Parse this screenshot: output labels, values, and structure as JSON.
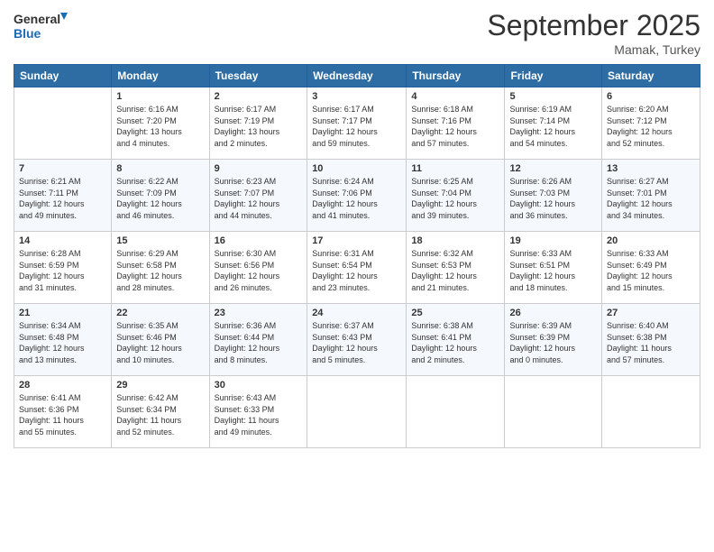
{
  "logo": {
    "line1": "General",
    "line2": "Blue"
  },
  "title": "September 2025",
  "location": "Mamak, Turkey",
  "days_header": [
    "Sunday",
    "Monday",
    "Tuesday",
    "Wednesday",
    "Thursday",
    "Friday",
    "Saturday"
  ],
  "weeks": [
    [
      {
        "day": "",
        "info": ""
      },
      {
        "day": "1",
        "info": "Sunrise: 6:16 AM\nSunset: 7:20 PM\nDaylight: 13 hours\nand 4 minutes."
      },
      {
        "day": "2",
        "info": "Sunrise: 6:17 AM\nSunset: 7:19 PM\nDaylight: 13 hours\nand 2 minutes."
      },
      {
        "day": "3",
        "info": "Sunrise: 6:17 AM\nSunset: 7:17 PM\nDaylight: 12 hours\nand 59 minutes."
      },
      {
        "day": "4",
        "info": "Sunrise: 6:18 AM\nSunset: 7:16 PM\nDaylight: 12 hours\nand 57 minutes."
      },
      {
        "day": "5",
        "info": "Sunrise: 6:19 AM\nSunset: 7:14 PM\nDaylight: 12 hours\nand 54 minutes."
      },
      {
        "day": "6",
        "info": "Sunrise: 6:20 AM\nSunset: 7:12 PM\nDaylight: 12 hours\nand 52 minutes."
      }
    ],
    [
      {
        "day": "7",
        "info": "Sunrise: 6:21 AM\nSunset: 7:11 PM\nDaylight: 12 hours\nand 49 minutes."
      },
      {
        "day": "8",
        "info": "Sunrise: 6:22 AM\nSunset: 7:09 PM\nDaylight: 12 hours\nand 46 minutes."
      },
      {
        "day": "9",
        "info": "Sunrise: 6:23 AM\nSunset: 7:07 PM\nDaylight: 12 hours\nand 44 minutes."
      },
      {
        "day": "10",
        "info": "Sunrise: 6:24 AM\nSunset: 7:06 PM\nDaylight: 12 hours\nand 41 minutes."
      },
      {
        "day": "11",
        "info": "Sunrise: 6:25 AM\nSunset: 7:04 PM\nDaylight: 12 hours\nand 39 minutes."
      },
      {
        "day": "12",
        "info": "Sunrise: 6:26 AM\nSunset: 7:03 PM\nDaylight: 12 hours\nand 36 minutes."
      },
      {
        "day": "13",
        "info": "Sunrise: 6:27 AM\nSunset: 7:01 PM\nDaylight: 12 hours\nand 34 minutes."
      }
    ],
    [
      {
        "day": "14",
        "info": "Sunrise: 6:28 AM\nSunset: 6:59 PM\nDaylight: 12 hours\nand 31 minutes."
      },
      {
        "day": "15",
        "info": "Sunrise: 6:29 AM\nSunset: 6:58 PM\nDaylight: 12 hours\nand 28 minutes."
      },
      {
        "day": "16",
        "info": "Sunrise: 6:30 AM\nSunset: 6:56 PM\nDaylight: 12 hours\nand 26 minutes."
      },
      {
        "day": "17",
        "info": "Sunrise: 6:31 AM\nSunset: 6:54 PM\nDaylight: 12 hours\nand 23 minutes."
      },
      {
        "day": "18",
        "info": "Sunrise: 6:32 AM\nSunset: 6:53 PM\nDaylight: 12 hours\nand 21 minutes."
      },
      {
        "day": "19",
        "info": "Sunrise: 6:33 AM\nSunset: 6:51 PM\nDaylight: 12 hours\nand 18 minutes."
      },
      {
        "day": "20",
        "info": "Sunrise: 6:33 AM\nSunset: 6:49 PM\nDaylight: 12 hours\nand 15 minutes."
      }
    ],
    [
      {
        "day": "21",
        "info": "Sunrise: 6:34 AM\nSunset: 6:48 PM\nDaylight: 12 hours\nand 13 minutes."
      },
      {
        "day": "22",
        "info": "Sunrise: 6:35 AM\nSunset: 6:46 PM\nDaylight: 12 hours\nand 10 minutes."
      },
      {
        "day": "23",
        "info": "Sunrise: 6:36 AM\nSunset: 6:44 PM\nDaylight: 12 hours\nand 8 minutes."
      },
      {
        "day": "24",
        "info": "Sunrise: 6:37 AM\nSunset: 6:43 PM\nDaylight: 12 hours\nand 5 minutes."
      },
      {
        "day": "25",
        "info": "Sunrise: 6:38 AM\nSunset: 6:41 PM\nDaylight: 12 hours\nand 2 minutes."
      },
      {
        "day": "26",
        "info": "Sunrise: 6:39 AM\nSunset: 6:39 PM\nDaylight: 12 hours\nand 0 minutes."
      },
      {
        "day": "27",
        "info": "Sunrise: 6:40 AM\nSunset: 6:38 PM\nDaylight: 11 hours\nand 57 minutes."
      }
    ],
    [
      {
        "day": "28",
        "info": "Sunrise: 6:41 AM\nSunset: 6:36 PM\nDaylight: 11 hours\nand 55 minutes."
      },
      {
        "day": "29",
        "info": "Sunrise: 6:42 AM\nSunset: 6:34 PM\nDaylight: 11 hours\nand 52 minutes."
      },
      {
        "day": "30",
        "info": "Sunrise: 6:43 AM\nSunset: 6:33 PM\nDaylight: 11 hours\nand 49 minutes."
      },
      {
        "day": "",
        "info": ""
      },
      {
        "day": "",
        "info": ""
      },
      {
        "day": "",
        "info": ""
      },
      {
        "day": "",
        "info": ""
      }
    ]
  ]
}
